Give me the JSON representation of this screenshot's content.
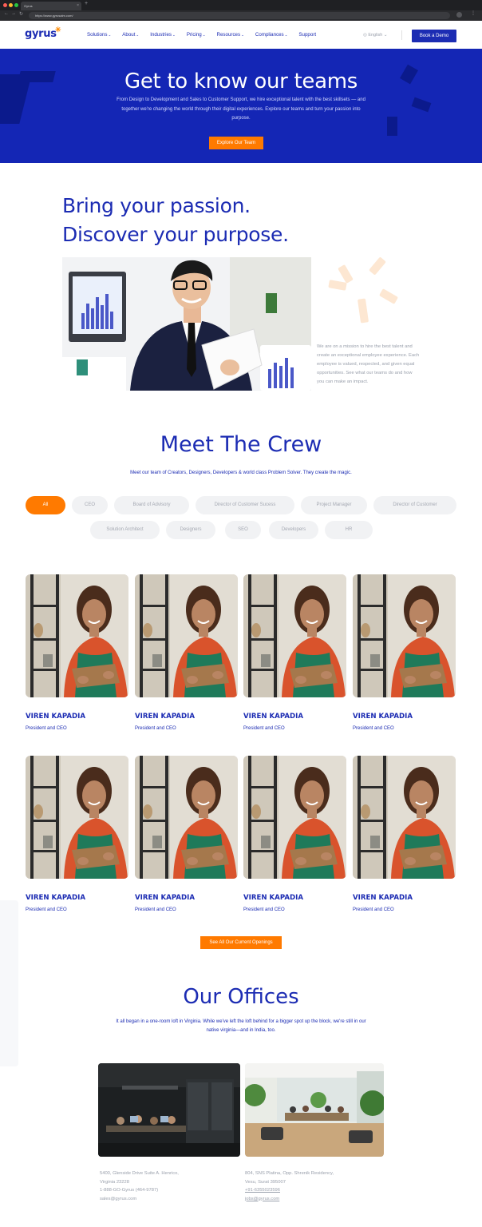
{
  "browser": {
    "tab_title": "Gyrus",
    "url": "https://www.gyrusaim.com/"
  },
  "header": {
    "logo": "gyrus",
    "menu": [
      {
        "label": "Solutions"
      },
      {
        "label": "About"
      },
      {
        "label": "Industries"
      },
      {
        "label": "Pricing"
      },
      {
        "label": "Resources"
      },
      {
        "label": "Compliances"
      },
      {
        "label": "Support"
      }
    ],
    "language": "English",
    "cta": "Book a Demo"
  },
  "hero": {
    "title": "Get to know our teams",
    "text": "From Design to Development and Sales to Customer Support, we hire exceptional talent with the best skillsets — and together we're changing the world through their digital experiences. Explore our teams and turn your passion into purpose.",
    "button": "Explore Our Team"
  },
  "passion": {
    "title_line1": "Bring your passion.",
    "title_line2": "Discover your purpose.",
    "text": "We are on a mission to hire the best talent and create an exceptional employee experience. Each employee is valued, respected, and given equal opportunities. See what our teams do and how you can make an impact."
  },
  "crew": {
    "title": "Meet The Crew",
    "subtitle": "Meet our team of Creators, Designers, Developers & world class Problem Solver. They create the magic.",
    "filters": [
      "All",
      "CEO",
      "Board of Advisory",
      "Director of Customer Sucess",
      "Project Manager",
      "Director of Customer",
      "Solution Architect",
      "Designers",
      "SEO",
      "Developers",
      "HR"
    ],
    "members": [
      {
        "name": "VIREN KAPADIA",
        "role": "President and CEO"
      },
      {
        "name": "VIREN KAPADIA",
        "role": "President and CEO"
      },
      {
        "name": "VIREN KAPADIA",
        "role": "President and CEO"
      },
      {
        "name": "VIREN KAPADIA",
        "role": "President and CEO"
      },
      {
        "name": "VIREN KAPADIA",
        "role": "President and CEO"
      },
      {
        "name": "VIREN KAPADIA",
        "role": "President and CEO"
      },
      {
        "name": "VIREN KAPADIA",
        "role": "President and CEO"
      },
      {
        "name": "VIREN KAPADIA",
        "role": "President and CEO"
      }
    ],
    "openings_button": "See All Our Current Openings"
  },
  "offices": {
    "title": "Our Offices",
    "text": "It all began in a one-room loft in Virginia. While we've left the loft behind for a bigger spot up the block, we're still in our native virginia—and in India, too.",
    "us": {
      "line1": "5400, Glenside Drive Suite A. Henrico,",
      "line2": "Virginia 23228",
      "phone": "1-888-GO-Gyrus (464-9787)",
      "email": "sales@gyrus.com"
    },
    "india": {
      "line1": "804, SNS Platina, Opp. Shrenik Residency,",
      "line2": "Vesu, Surat 395007",
      "phone": "+91-6355023596",
      "email": "jobs@gyrus.com"
    }
  },
  "colors": {
    "brand_blue": "#1c2cb3",
    "hero_blue": "#1426b5",
    "accent_orange": "#ff7a00"
  }
}
